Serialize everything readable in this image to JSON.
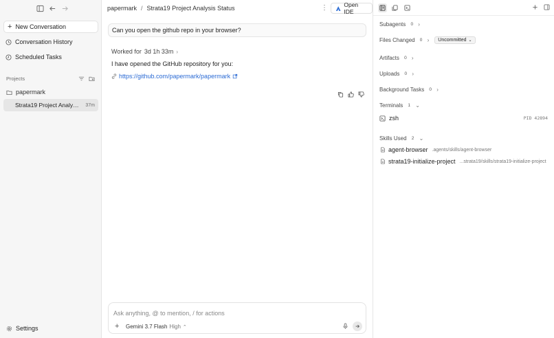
{
  "sidebar": {
    "new_conversation": "New Conversation",
    "nav": [
      {
        "label": "Conversation History",
        "icon": "history-icon"
      },
      {
        "label": "Scheduled Tasks",
        "icon": "clock-icon"
      }
    ],
    "projects_label": "Projects",
    "project_name": "papermark",
    "active_conversation": {
      "title": "Strata19 Project Analysis Status",
      "age": "37m"
    },
    "settings_label": "Settings"
  },
  "header": {
    "breadcrumb_project": "papermark",
    "breadcrumb_separator": "/",
    "breadcrumb_title": "Strata19 Project Analysis Status",
    "open_ide_label": "Open IDE"
  },
  "chat": {
    "user_message": "Can you open the github repo in your browser?",
    "worked_prefix": "Worked for",
    "worked_duration": "3d 1h 33m",
    "assistant_reply": "I have opened the GitHub repository for you:",
    "link_text": "https://github.com/papermark/papermark"
  },
  "composer": {
    "placeholder": "Ask anything, @ to mention, / for actions",
    "model_name": "Gemini 3.7 Flash",
    "model_level": "High"
  },
  "panel": {
    "subagents": {
      "label": "Subagents",
      "count": "0"
    },
    "files_changed": {
      "label": "Files Changed",
      "count": "0",
      "filter": "Uncommitted"
    },
    "artifacts": {
      "label": "Artifacts",
      "count": "0"
    },
    "uploads": {
      "label": "Uploads",
      "count": "0"
    },
    "background_tasks": {
      "label": "Background Tasks",
      "count": "0"
    },
    "terminals": {
      "label": "Terminals",
      "count": "1",
      "items": [
        {
          "name": "zsh",
          "pid": "PID 42894"
        }
      ]
    },
    "skills": {
      "label": "Skills Used",
      "count": "2",
      "items": [
        {
          "name": "agent-browser",
          "path": ".agents/skills/agent-browser"
        },
        {
          "name": "strata19-initialize-project",
          "path": "...strata19/skills/strata19-initialize-project"
        }
      ]
    }
  },
  "colors": {
    "link": "#2a6ad4",
    "sidebar_bg": "#f6f6f6",
    "active_item_bg": "#e6e6e6"
  }
}
